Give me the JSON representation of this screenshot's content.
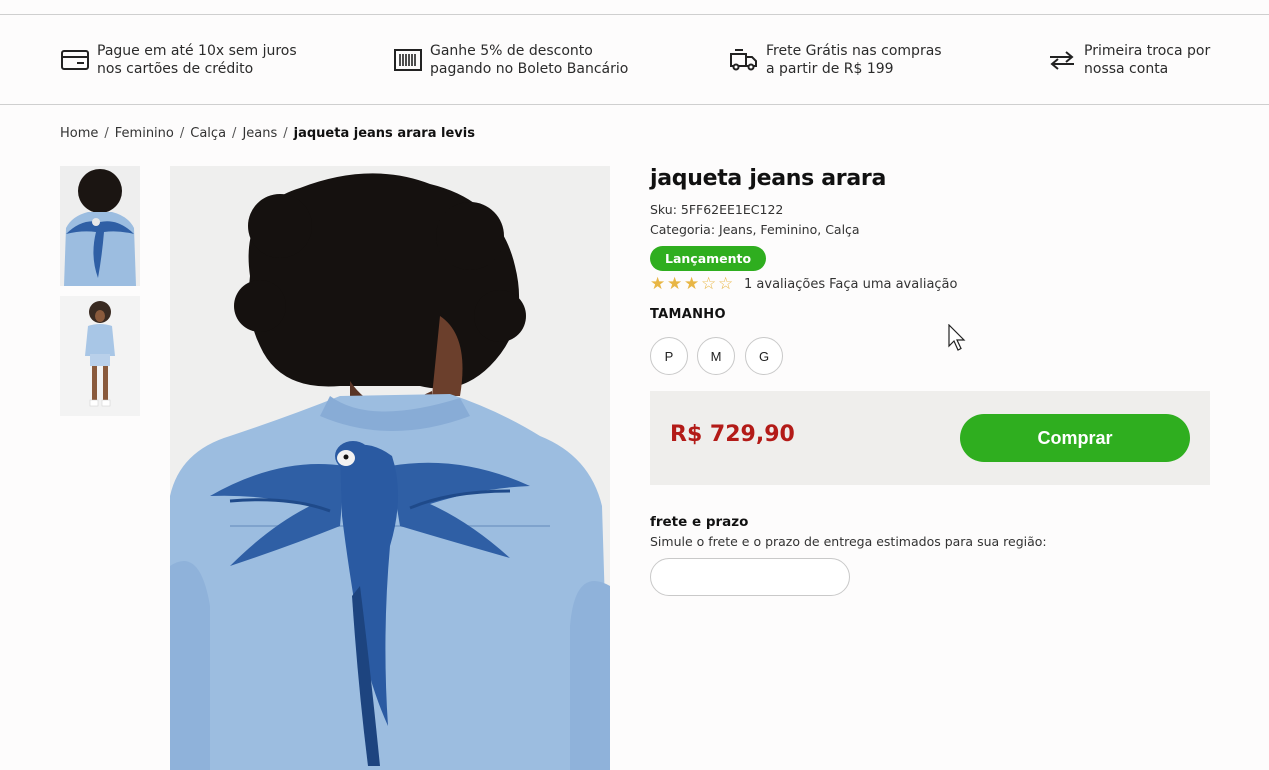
{
  "benefits": [
    {
      "icon": "credit-card-icon",
      "line1": "Pague em até 10x sem juros",
      "line2": "nos cartões de crédito"
    },
    {
      "icon": "barcode-icon",
      "line1": "Ganhe 5% de desconto",
      "line2": "pagando no Boleto Bancário"
    },
    {
      "icon": "truck-icon",
      "line1": "Frete Grátis nas compras",
      "line2": "a partir de R$ 199"
    },
    {
      "icon": "exchange-arrows-icon",
      "line1": "Primeira troca por",
      "line2": "nossa conta"
    }
  ],
  "breadcrumb": {
    "items": [
      "Home",
      "Feminino",
      "Calça",
      "Jeans"
    ],
    "current": "jaqueta jeans arara levis",
    "separator": "/"
  },
  "product": {
    "title": "jaqueta jeans arara",
    "sku": "Sku: 5FF62EE1EC122",
    "category": "Categoria: Jeans,  Feminino,  Calça",
    "badge": "Lançamento",
    "rating": 3,
    "rating_max": 5,
    "reviews_text": "1 avaliações",
    "review_link": "Faça uma avaliação",
    "size_label": "TAMANHO",
    "sizes": [
      "P",
      "M",
      "G"
    ],
    "price": "R$ 729,90",
    "buy_label": "Comprar"
  },
  "shipping": {
    "title": "frete e prazo",
    "description": "Simule o frete e o prazo de entrega estimados para sua região:",
    "input_placeholder": ""
  },
  "colors": {
    "accent_green": "#2fae1f",
    "price_red": "#b31b18",
    "star_gold": "#e8b645",
    "buy_box_bg": "#efeeec",
    "denim_light": "#9cbde0",
    "parrot_blue": "#2f5fa5"
  }
}
